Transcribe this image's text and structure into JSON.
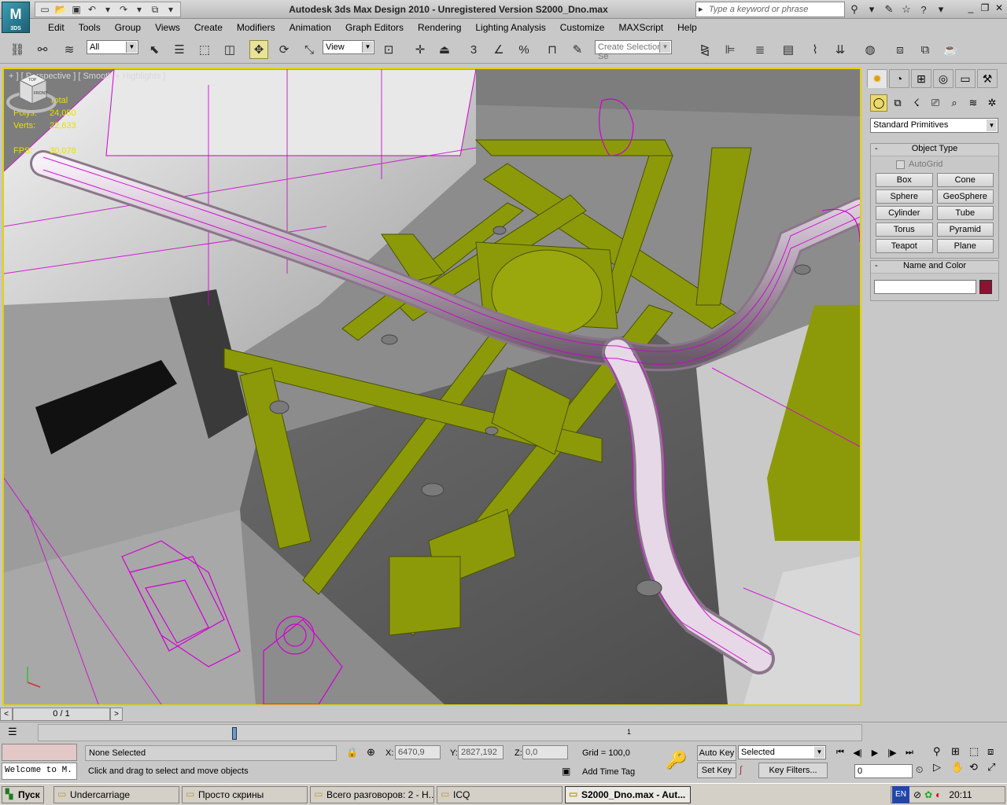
{
  "app": {
    "logo_text": "M",
    "logo_sub": "3DS",
    "window_title": "Autodesk 3ds Max Design 2010   -   Unregistered Version     S2000_Dno.max",
    "search_placeholder": "Type a keyword or phrase"
  },
  "menu": [
    "Edit",
    "Tools",
    "Group",
    "Views",
    "Create",
    "Modifiers",
    "Animation",
    "Graph Editors",
    "Rendering",
    "Lighting Analysis",
    "Customize",
    "MAXScript",
    "Help"
  ],
  "toolbar": {
    "selection_filter": "All",
    "ref_coord": "View",
    "named_selection_placeholder": "Create Selection Se",
    "snap_label": "3"
  },
  "viewport": {
    "label": "+ ] [ Perspective ] [ Smooth + Highlights ]",
    "stats": [
      {
        "key": "",
        "value": "Total"
      },
      {
        "key": "Polys:",
        "value": "24,050"
      },
      {
        "key": "Verts:",
        "value": "22,633"
      },
      {
        "key": "",
        "value": ""
      },
      {
        "key": "FPS:",
        "value": "30,078"
      }
    ],
    "viewcube": {
      "top": "TOP",
      "front": "FRONT"
    }
  },
  "command_panel": {
    "primitive_type": "Standard Primitives",
    "object_type_title": "Object Type",
    "autogrid_label": "AutoGrid",
    "object_buttons": [
      "Box",
      "Cone",
      "Sphere",
      "GeoSphere",
      "Cylinder",
      "Tube",
      "Torus",
      "Pyramid",
      "Teapot",
      "Plane"
    ],
    "name_color_title": "Name and Color",
    "object_color": "#8c1232"
  },
  "timeline": {
    "frame_display": "0 / 1",
    "track_tick": "1"
  },
  "status": {
    "listener_text": "Welcome to M.",
    "selection": "None Selected",
    "prompt": "Click and drag to select and move objects",
    "x_label": "X:",
    "x_value": "6470,9",
    "y_label": "Y:",
    "y_value": "2827,192",
    "z_label": "Z:",
    "z_value": "0,0",
    "grid": "Grid = 100,0",
    "add_time_tag": "Add Time Tag",
    "auto_key": "Auto Key",
    "set_key": "Set Key",
    "selected_dd": "Selected",
    "key_filters": "Key Filters...",
    "current_frame": "0"
  },
  "taskbar": {
    "start": "Пуск",
    "tasks": [
      "Undercarriage",
      "Просто скрины",
      "Всего разговоров: 2 - Н...",
      "ICQ",
      "S2000_Dno.max - Aut..."
    ],
    "lang": "EN",
    "clock": "20:11"
  },
  "colors": {
    "viewport_border": "#e3d200",
    "wire_magenta": "#d000d0",
    "frame_olive": "#8c9a0a",
    "object_color": "#8c1232"
  }
}
